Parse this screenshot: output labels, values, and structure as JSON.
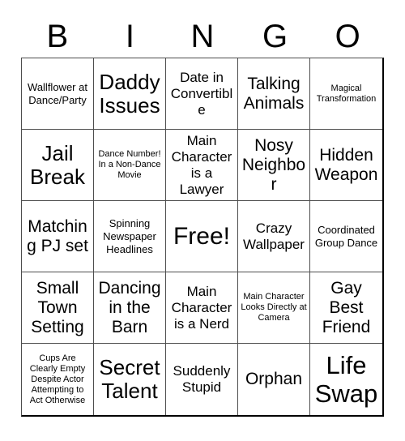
{
  "card": {
    "header_letters": [
      "B",
      "I",
      "N",
      "G",
      "O"
    ],
    "free_space_label": "Free!",
    "grid_size": "5x5",
    "colors": {
      "background": "#ffffff",
      "text": "#000000",
      "gridline": "#4d4d4d",
      "outer_border": "#000000"
    },
    "rows": [
      [
        {
          "label": "Wallflower at Dance/Party",
          "size": "sm"
        },
        {
          "label": "Daddy Issues",
          "size": "xl"
        },
        {
          "label": "Date in Convertible",
          "size": "md"
        },
        {
          "label": "Talking Animals",
          "size": "lg"
        },
        {
          "label": "Magical Transformation",
          "size": "xs"
        }
      ],
      [
        {
          "label": "Jail Break",
          "size": "xl"
        },
        {
          "label": "Dance Number! In a Non-Dance Movie",
          "size": "xs"
        },
        {
          "label": "Main Character is a Lawyer",
          "size": "md"
        },
        {
          "label": "Nosy Neighbor",
          "size": "lg"
        },
        {
          "label": "Hidden Weapon",
          "size": "lg"
        }
      ],
      [
        {
          "label": "Matching PJ set",
          "size": "lg"
        },
        {
          "label": "Spinning Newspaper Headlines",
          "size": "sm"
        },
        {
          "label": "Free!",
          "size": "free"
        },
        {
          "label": "Crazy Wallpaper",
          "size": "md"
        },
        {
          "label": "Coordinated Group Dance",
          "size": "sm"
        }
      ],
      [
        {
          "label": "Small Town Setting",
          "size": "lg"
        },
        {
          "label": "Dancing in the Barn",
          "size": "lg"
        },
        {
          "label": "Main Character is a Nerd",
          "size": "md"
        },
        {
          "label": "Main Character Looks Directly at Camera",
          "size": "xs"
        },
        {
          "label": "Gay Best Friend",
          "size": "lg"
        }
      ],
      [
        {
          "label": "Cups Are Clearly Empty Despite Actor Attempting to Act Otherwise",
          "size": "xs"
        },
        {
          "label": "Secret Talent",
          "size": "xl"
        },
        {
          "label": "Suddenly Stupid",
          "size": "md"
        },
        {
          "label": "Orphan",
          "size": "lg"
        },
        {
          "label": "Life Swap",
          "size": "xxl"
        }
      ]
    ]
  }
}
